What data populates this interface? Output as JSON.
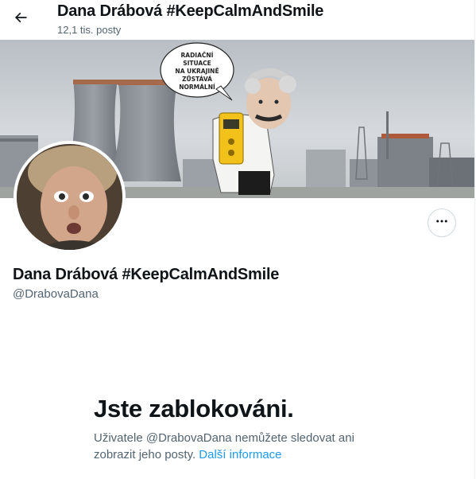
{
  "header": {
    "back_icon": "arrow-left-icon",
    "name": "Dana Drábová #KeepCalmAndSmile",
    "posts_count": "12,1 tis. posty"
  },
  "banner": {
    "speech_lines": [
      "RADIAČNÍ",
      "SITUACE",
      "NA UKRAJINĚ",
      "ZŮSTÁVÁ",
      "NORMÁLNÍ"
    ]
  },
  "profile": {
    "display_name": "Dana Drábová #KeepCalmAndSmile",
    "handle": "@DrabovaDana",
    "more_icon": "more-horizontal-icon"
  },
  "blocked": {
    "title": "Jste zablokováni.",
    "message_part1": "Uživatele @DrabovaDana nemůžete sledovat ani zobrazit jeho posty.",
    "link_text": "Další informace"
  },
  "colors": {
    "text_primary": "#0f1419",
    "text_secondary": "#536471",
    "link": "#1d9bf0",
    "border": "#cfd9de"
  }
}
